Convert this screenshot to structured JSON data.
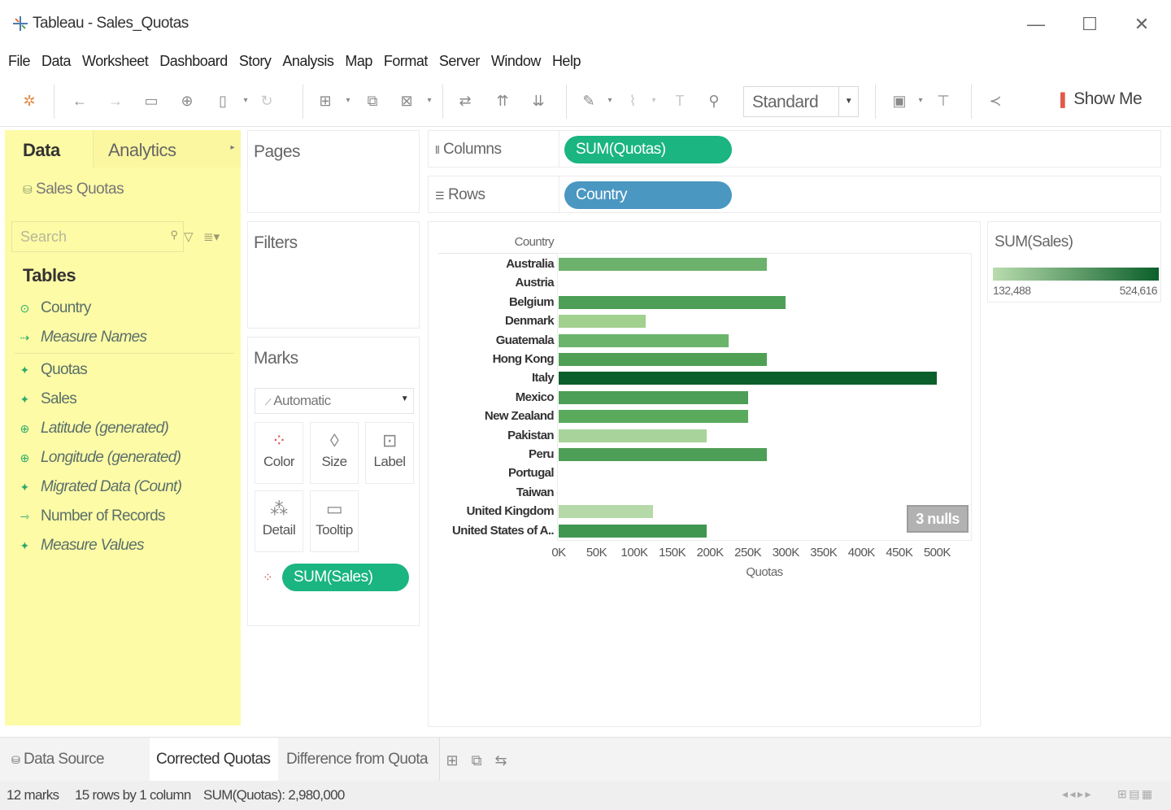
{
  "window": {
    "title": "Tableau - Sales_Quotas",
    "minimize": "—",
    "maximize": "☐",
    "close": "✕"
  },
  "menu": [
    "File",
    "Data",
    "Worksheet",
    "Dashboard",
    "Story",
    "Analysis",
    "Map",
    "Format",
    "Server",
    "Window",
    "Help"
  ],
  "toolbar": {
    "fit_value": "Standard",
    "show_me_label": "Show Me"
  },
  "data_pane": {
    "tab_data": "Data",
    "tab_analytics": "Analytics",
    "datasource": "Sales Quotas",
    "search_placeholder": "Search",
    "tables_heading": "Tables",
    "fields": [
      {
        "label": "Country",
        "kind": "dimension",
        "italic": false
      },
      {
        "label": "Measure Names",
        "kind": "dimension",
        "italic": true
      },
      {
        "label": "Quotas",
        "kind": "measure",
        "italic": false
      },
      {
        "label": "Sales",
        "kind": "measure",
        "italic": false
      },
      {
        "label": "Latitude (generated)",
        "kind": "measure",
        "italic": true
      },
      {
        "label": "Longitude (generated)",
        "kind": "measure",
        "italic": true
      },
      {
        "label": "Migrated Data (Count)",
        "kind": "measure",
        "italic": true
      },
      {
        "label": "Number of Records",
        "kind": "measure",
        "italic": false
      },
      {
        "label": "Measure Values",
        "kind": "measure",
        "italic": true
      }
    ]
  },
  "shelves": {
    "pages": "Pages",
    "filters": "Filters",
    "columns_label": "Columns",
    "columns_pill": "SUM(Quotas)",
    "rows_label": "Rows",
    "rows_pill": "Country"
  },
  "marks": {
    "title": "Marks",
    "mark_type": "Automatic",
    "buttons": [
      "Color",
      "Size",
      "Label",
      "Detail",
      "Tooltip"
    ],
    "color_pill": "SUM(Sales)"
  },
  "legend": {
    "title": "SUM(Sales)",
    "min": "132,488",
    "max": "524,616",
    "color_low": "#b9dcae",
    "color_high": "#0b5f2a"
  },
  "chart_data": {
    "type": "bar",
    "orientation": "horizontal",
    "row_header": "Country",
    "xlabel": "Quotas",
    "xlim": [
      0,
      520000
    ],
    "xticks": [
      "0K",
      "50K",
      "100K",
      "150K",
      "200K",
      "250K",
      "300K",
      "350K",
      "400K",
      "450K",
      "500K"
    ],
    "categories": [
      "Australia",
      "Austria",
      "Belgium",
      "Denmark",
      "Guatemala",
      "Hong Kong",
      "Italy",
      "Mexico",
      "New Zealand",
      "Pakistan",
      "Peru",
      "Portugal",
      "Taiwan",
      "United Kingdom",
      "United States of A.."
    ],
    "values": [
      275000,
      null,
      300000,
      115000,
      225000,
      275000,
      500000,
      250000,
      250000,
      195000,
      275000,
      null,
      null,
      125000,
      195000
    ],
    "colors": [
      "#6cb26c",
      null,
      "#4d9e56",
      "#a2d08f",
      "#6bb46b",
      "#4fa055",
      "#0b5f2a",
      "#4d9e56",
      "#5aaa5e",
      "#a8d39a",
      "#4d9e56",
      null,
      null,
      "#b5d9a9",
      "#3f9750"
    ],
    "nulls_badge": "3 nulls"
  },
  "sheet_tabs": {
    "data_source": "Data Source",
    "tabs": [
      "Corrected Quotas",
      "Difference from Quota"
    ]
  },
  "status": {
    "marks": "12 marks",
    "rows_cols": "15 rows by 1 column",
    "sum": "SUM(Quotas): 2,980,000"
  }
}
